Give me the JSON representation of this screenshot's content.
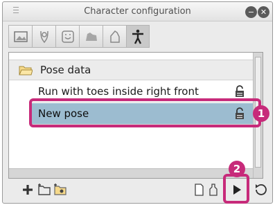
{
  "window": {
    "title": "Character configuration",
    "minimize_icon": "minimize-icon",
    "close_icon": "close-icon"
  },
  "tabs": [
    {
      "icon": "image-icon",
      "active": false
    },
    {
      "icon": "hair-icon",
      "active": false
    },
    {
      "icon": "face-icon",
      "active": false
    },
    {
      "icon": "animal-icon",
      "active": false
    },
    {
      "icon": "hand-icon",
      "active": false
    },
    {
      "icon": "pose-figure-icon",
      "active": true
    }
  ],
  "folder": {
    "label": "Pose data",
    "icon": "folder-icon"
  },
  "items": [
    {
      "label": "Run with toes inside right front",
      "lock_icon": "lock-icon",
      "selected": false
    },
    {
      "label": "New pose",
      "lock_icon": "unlock-icon",
      "selected": true
    }
  ],
  "annotations": [
    "1",
    "2"
  ],
  "footer": {
    "left_buttons": [
      "add-icon",
      "new-folder-icon",
      "new-set-icon"
    ],
    "right_buttons": [
      "page-icon",
      "bottle-icon",
      "play-icon",
      "reset-icon"
    ]
  },
  "colors": {
    "highlight": "#c72a7a",
    "selection": "#9cbcd0"
  }
}
